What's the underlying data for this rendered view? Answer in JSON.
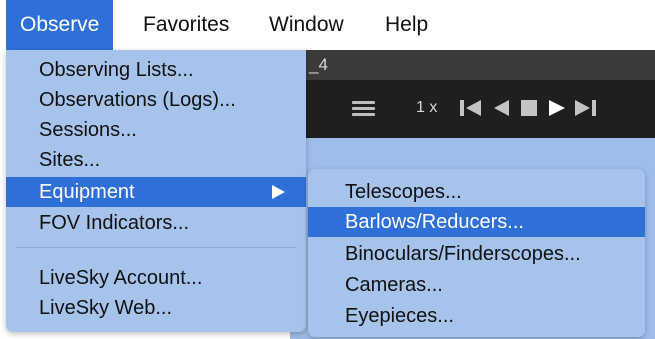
{
  "menubar": {
    "items": [
      {
        "label": "Observe",
        "active": true
      },
      {
        "label": "Favorites",
        "active": false
      },
      {
        "label": "Window",
        "active": false
      },
      {
        "label": "Help",
        "active": false
      }
    ]
  },
  "background_window": {
    "title_fragment": "_4",
    "speed_label": "1 x",
    "icons": [
      "hamburger-menu-icon",
      "skip-to-start-icon",
      "step-back-icon",
      "stop-icon",
      "play-icon",
      "skip-to-end-icon"
    ]
  },
  "observe_menu": {
    "items": [
      {
        "label": "Observing Lists...",
        "highlighted": false
      },
      {
        "label": "Observations (Logs)...",
        "highlighted": false
      },
      {
        "label": "Sessions...",
        "highlighted": false
      },
      {
        "label": "Sites...",
        "highlighted": false
      },
      {
        "label": "Equipment",
        "highlighted": true,
        "has_submenu": true
      },
      {
        "label": "FOV Indicators...",
        "highlighted": false
      },
      {
        "label": "LiveSky Account...",
        "highlighted": false
      },
      {
        "label": "LiveSky Web...",
        "highlighted": false
      }
    ]
  },
  "equipment_submenu": {
    "items": [
      {
        "label": "Telescopes...",
        "highlighted": false
      },
      {
        "label": "Barlows/Reducers...",
        "highlighted": true
      },
      {
        "label": "Binoculars/Finderscopes...",
        "highlighted": false
      },
      {
        "label": "Cameras...",
        "highlighted": false
      },
      {
        "label": "Eyepieces...",
        "highlighted": false
      }
    ]
  },
  "colors": {
    "accent": "#2f6fd8",
    "menu_background": "#a6c3ec",
    "toolbar_background": "#1f1f1f"
  }
}
